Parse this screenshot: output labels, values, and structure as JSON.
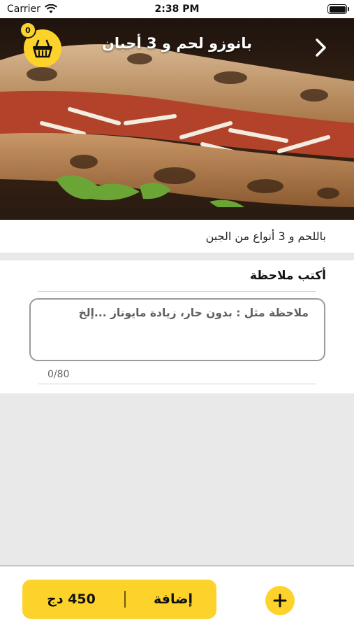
{
  "status_bar": {
    "carrier": "Carrier",
    "time": "2:38 PM",
    "wifi_icon": "wifi-icon",
    "battery_icon": "battery-icon"
  },
  "header": {
    "title": "بانوزو لحم و 3 أجبان",
    "back_icon": "chevron-right-icon",
    "cart_icon": "basket-icon",
    "cart_count": "0"
  },
  "product": {
    "description": "باللحم و 3 أنواع من الجبن"
  },
  "note": {
    "heading": "أكتب ملاحظة",
    "value": "",
    "placeholder": "ملاحظة مثل : بدون حار، زيادة مايوناز ...إلخ",
    "counter": "0/80"
  },
  "bottom_bar": {
    "price": "450 دج",
    "add_label": "إضافة",
    "plus_icon": "plus-icon"
  },
  "colors": {
    "accent": "#fdd32b",
    "background": "#e9e9e9",
    "surface": "#ffffff"
  }
}
